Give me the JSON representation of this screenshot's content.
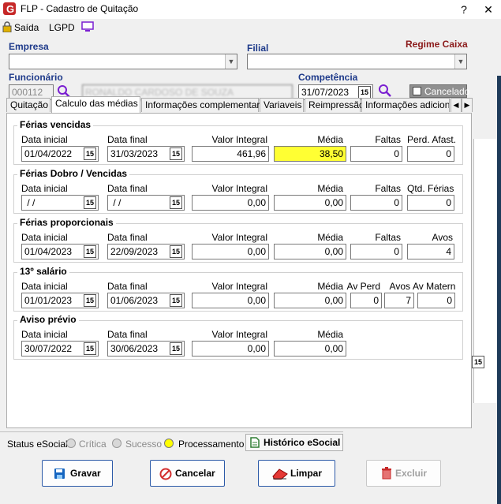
{
  "window": {
    "title": "FLP - Cadastro de Quitação",
    "help": "?",
    "close": "✕"
  },
  "menu": {
    "saida": "Saída",
    "lgpd": "LGPD"
  },
  "header": {
    "empresa_label": "Empresa",
    "filial_label": "Filial",
    "regime_label": "Regime Caixa",
    "funcionario_label": "Funcionário",
    "funcionario_code": "000112",
    "funcionario_name": "RONALDO CARDOSO DE SOUZA",
    "competencia_label": "Competência",
    "competencia_value": "31/07/2023",
    "cancelado_label": "Cancelado"
  },
  "tabs": [
    "Quitação",
    "Calculo das médias",
    "Informações complementares",
    "Variaveis",
    "Reimpressão",
    "Informações adicionais"
  ],
  "labels": {
    "data_inicial": "Data inicial",
    "data_final": "Data final",
    "valor_integral": "Valor Integral",
    "media": "Média",
    "faltas": "Faltas",
    "perd_afast": "Perd. Afast.",
    "qtd_ferias": "Qtd. Férias",
    "avos": "Avos",
    "av_perd": "Av Perd",
    "av_matern": "Av Matern"
  },
  "ferias_vencidas": {
    "title": "Férias vencidas",
    "data_inicial": "01/04/2022",
    "data_final": "31/03/2023",
    "valor_integral": "461,96",
    "media": "38,50",
    "faltas": "0",
    "perd_afast": "0"
  },
  "ferias_dobro": {
    "title": "Férias Dobro / Vencidas",
    "data_inicial": " / /",
    "data_final": " / /",
    "valor_integral": "0,00",
    "media": "0,00",
    "faltas": "0",
    "qtd_ferias": "0"
  },
  "ferias_prop": {
    "title": "Férias proporcionais",
    "data_inicial": "01/04/2023",
    "data_final": "22/09/2023",
    "valor_integral": "0,00",
    "media": "0,00",
    "faltas": "0",
    "avos": "4"
  },
  "decimo": {
    "title": "13º salário",
    "data_inicial": "01/01/2023",
    "data_final": "01/06/2023",
    "valor_integral": "0,00",
    "media": "0,00",
    "av_perd": "0",
    "avos": "7",
    "av_matern": "0"
  },
  "aviso": {
    "title": "Aviso prévio",
    "data_inicial": "30/07/2022",
    "data_final": "30/06/2023",
    "valor_integral": "0,00",
    "media": "0,00"
  },
  "status": {
    "label": "Status eSocial:",
    "critica": "Crítica",
    "sucesso": "Sucesso",
    "processamento": "Processamento",
    "historico": "Histórico eSocial"
  },
  "buttons": {
    "gravar": "Gravar",
    "cancelar": "Cancelar",
    "limpar": "Limpar",
    "excluir": "Excluir"
  },
  "calendar_glyph": "15",
  "colors": {
    "highlight": "#ffff33",
    "accent_blue": "#1e3a8a",
    "regime_red": "#8b1a1a",
    "search_purple": "#7a1fd1"
  }
}
